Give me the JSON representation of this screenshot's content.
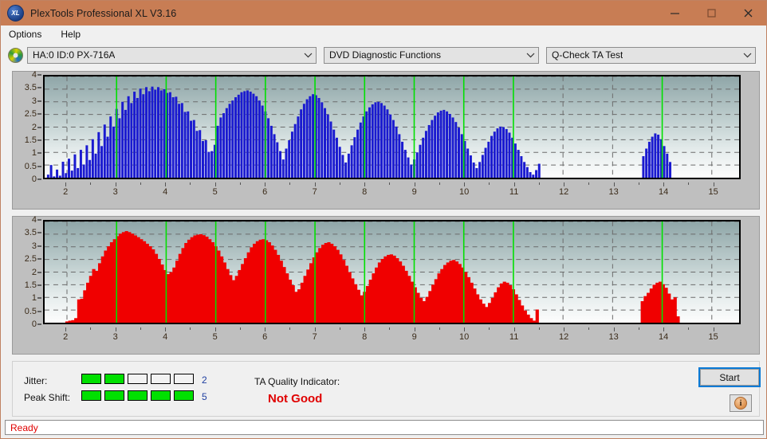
{
  "window": {
    "title": "PlexTools Professional XL V3.16",
    "logo_text": "XL",
    "controls": {
      "minimize": "minimize-icon",
      "maximize": "maximize-icon",
      "close": "close-icon"
    }
  },
  "menu": {
    "items": [
      "Options",
      "Help"
    ]
  },
  "toolbar": {
    "drive": "HA:0 ID:0  PX-716A",
    "function": "DVD Diagnostic Functions",
    "test": "Q-Check TA Test",
    "drive_icon": "disc-icon",
    "chevron": "∨"
  },
  "indicators": {
    "jitter_label": "Jitter:",
    "jitter_value": "2",
    "jitter_filled": 2,
    "jitter_total": 5,
    "peak_shift_label": "Peak Shift:",
    "peak_shift_value": "5",
    "peak_shift_filled": 5,
    "peak_shift_total": 5,
    "tqi_label": "TA Quality Indicator:",
    "tqi_value": "Not Good",
    "tqi_color": "#e00000"
  },
  "buttons": {
    "start": "Start",
    "info": "i"
  },
  "status": {
    "text": "Ready"
  },
  "colors": {
    "titlebar": "#c87d54",
    "top_series": "#1a1ad0",
    "bottom_series": "#f00000",
    "marker": "#00e000",
    "plot_border": "#000000"
  },
  "chart_data": [
    {
      "type": "bar",
      "title": "",
      "xlabel": "",
      "ylabel": "",
      "xlim": [
        1.55,
        15.55
      ],
      "ylim": [
        0,
        4
      ],
      "yticks": [
        0,
        0.5,
        1,
        1.5,
        2,
        2.5,
        3,
        3.5,
        4
      ],
      "xticks": [
        2,
        3,
        4,
        5,
        6,
        7,
        8,
        9,
        10,
        11,
        12,
        13,
        14,
        15
      ],
      "grid": true,
      "series_color": "#1a1ad0",
      "markers": [
        3,
        4,
        5,
        6,
        7,
        8,
        9,
        10,
        11,
        14
      ],
      "marker_color": "#00e000",
      "x": [
        1.62,
        1.68,
        1.74,
        1.8,
        1.86,
        1.92,
        1.98,
        2.04,
        2.1,
        2.16,
        2.22,
        2.28,
        2.34,
        2.4,
        2.46,
        2.52,
        2.58,
        2.64,
        2.7,
        2.76,
        2.82,
        2.88,
        2.94,
        3.0,
        3.06,
        3.12,
        3.18,
        3.24,
        3.3,
        3.36,
        3.42,
        3.48,
        3.54,
        3.6,
        3.66,
        3.72,
        3.78,
        3.84,
        3.9,
        3.96,
        4.02,
        4.08,
        4.14,
        4.2,
        4.26,
        4.32,
        4.38,
        4.44,
        4.5,
        4.56,
        4.62,
        4.68,
        4.74,
        4.8,
        4.86,
        4.92,
        4.98,
        5.04,
        5.1,
        5.16,
        5.22,
        5.28,
        5.34,
        5.4,
        5.46,
        5.52,
        5.58,
        5.64,
        5.7,
        5.76,
        5.82,
        5.88,
        5.94,
        6.0,
        6.06,
        6.12,
        6.18,
        6.24,
        6.3,
        6.36,
        6.42,
        6.48,
        6.54,
        6.6,
        6.66,
        6.72,
        6.78,
        6.84,
        6.9,
        6.96,
        7.02,
        7.08,
        7.14,
        7.2,
        7.26,
        7.32,
        7.38,
        7.44,
        7.5,
        7.56,
        7.62,
        7.68,
        7.74,
        7.8,
        7.86,
        7.92,
        7.98,
        8.04,
        8.1,
        8.16,
        8.22,
        8.28,
        8.34,
        8.4,
        8.46,
        8.52,
        8.58,
        8.64,
        8.7,
        8.76,
        8.82,
        8.88,
        8.94,
        9.0,
        9.06,
        9.12,
        9.18,
        9.24,
        9.3,
        9.36,
        9.42,
        9.48,
        9.54,
        9.6,
        9.66,
        9.72,
        9.78,
        9.84,
        9.9,
        9.96,
        10.02,
        10.08,
        10.14,
        10.2,
        10.26,
        10.32,
        10.38,
        10.44,
        10.5,
        10.56,
        10.62,
        10.68,
        10.74,
        10.8,
        10.86,
        10.92,
        10.98,
        11.04,
        11.1,
        11.16,
        11.22,
        11.28,
        11.34,
        11.4,
        11.46,
        11.52,
        13.62,
        13.68,
        13.74,
        13.8,
        13.86,
        13.92,
        13.98,
        14.04,
        14.1,
        14.16,
        14.22,
        14.28
      ],
      "values": [
        0.12,
        0.5,
        0.05,
        0.32,
        0.08,
        0.63,
        0.18,
        0.75,
        0.28,
        0.92,
        0.38,
        1.1,
        0.52,
        1.28,
        0.7,
        1.52,
        0.95,
        1.8,
        1.25,
        2.1,
        1.62,
        2.42,
        2.02,
        2.72,
        2.35,
        3.0,
        2.68,
        3.22,
        2.95,
        3.4,
        3.15,
        3.52,
        3.3,
        3.58,
        3.42,
        3.6,
        3.48,
        3.58,
        3.45,
        3.5,
        3.35,
        3.38,
        3.18,
        3.2,
        2.92,
        2.95,
        2.6,
        2.62,
        2.25,
        2.28,
        1.85,
        1.88,
        1.45,
        1.48,
        1.02,
        1.05,
        1.3,
        2.05,
        2.38,
        2.55,
        2.75,
        2.92,
        3.05,
        3.18,
        3.28,
        3.38,
        3.42,
        3.45,
        3.4,
        3.32,
        3.22,
        3.05,
        2.85,
        2.62,
        2.35,
        2.05,
        1.72,
        1.4,
        1.05,
        0.72,
        1.15,
        1.48,
        1.82,
        2.12,
        2.42,
        2.7,
        2.92,
        3.1,
        3.22,
        3.3,
        3.26,
        3.15,
        2.98,
        2.75,
        2.5,
        2.22,
        1.9,
        1.58,
        1.22,
        0.9,
        0.6,
        0.95,
        1.28,
        1.6,
        1.9,
        2.18,
        2.42,
        2.62,
        2.78,
        2.9,
        2.98,
        3.0,
        2.95,
        2.85,
        2.7,
        2.5,
        2.28,
        2.02,
        1.72,
        1.42,
        1.1,
        0.8,
        0.52,
        0.72,
        1.0,
        1.3,
        1.58,
        1.85,
        2.08,
        2.28,
        2.45,
        2.58,
        2.65,
        2.68,
        2.62,
        2.52,
        2.38,
        2.2,
        1.98,
        1.72,
        1.45,
        1.15,
        0.88,
        0.6,
        0.38,
        0.62,
        0.9,
        1.18,
        1.42,
        1.65,
        1.82,
        1.95,
        2.02,
        2.0,
        1.92,
        1.78,
        1.58,
        1.35,
        1.1,
        0.85,
        0.62,
        0.42,
        0.22,
        0.12,
        0.3,
        0.55,
        0.85,
        1.15,
        1.42,
        1.62,
        1.75,
        1.7,
        1.52,
        1.25,
        0.95,
        0.62
      ]
    },
    {
      "type": "bar",
      "title": "",
      "xlabel": "",
      "ylabel": "",
      "xlim": [
        1.55,
        15.55
      ],
      "ylim": [
        0,
        4
      ],
      "yticks": [
        0,
        0.5,
        1,
        1.5,
        2,
        2.5,
        3,
        3.5,
        4
      ],
      "xticks": [
        2,
        3,
        4,
        5,
        6,
        7,
        8,
        9,
        10,
        11,
        12,
        13,
        14,
        15
      ],
      "grid": true,
      "series_color": "#f00000",
      "markers": [
        3,
        4,
        5,
        6,
        7,
        8,
        9,
        10,
        11,
        14
      ],
      "marker_color": "#00e000",
      "x": [
        2.0,
        2.06,
        2.12,
        2.18,
        2.24,
        2.3,
        2.36,
        2.42,
        2.48,
        2.54,
        2.6,
        2.66,
        2.72,
        2.78,
        2.84,
        2.9,
        2.96,
        3.02,
        3.08,
        3.14,
        3.2,
        3.26,
        3.32,
        3.38,
        3.44,
        3.5,
        3.56,
        3.62,
        3.68,
        3.74,
        3.8,
        3.86,
        3.92,
        3.98,
        4.04,
        4.1,
        4.16,
        4.22,
        4.28,
        4.34,
        4.4,
        4.46,
        4.52,
        4.58,
        4.64,
        4.7,
        4.76,
        4.82,
        4.88,
        4.94,
        5.0,
        5.06,
        5.12,
        5.18,
        5.24,
        5.3,
        5.36,
        5.42,
        5.48,
        5.54,
        5.6,
        5.66,
        5.72,
        5.78,
        5.84,
        5.9,
        5.96,
        6.02,
        6.08,
        6.14,
        6.2,
        6.26,
        6.32,
        6.38,
        6.44,
        6.5,
        6.56,
        6.62,
        6.68,
        6.74,
        6.8,
        6.86,
        6.92,
        6.98,
        7.04,
        7.1,
        7.16,
        7.22,
        7.28,
        7.34,
        7.4,
        7.46,
        7.52,
        7.58,
        7.64,
        7.7,
        7.76,
        7.82,
        7.88,
        7.94,
        8.0,
        8.06,
        8.12,
        8.18,
        8.24,
        8.3,
        8.36,
        8.42,
        8.48,
        8.54,
        8.6,
        8.66,
        8.72,
        8.78,
        8.84,
        8.9,
        8.96,
        9.02,
        9.08,
        9.14,
        9.2,
        9.26,
        9.32,
        9.38,
        9.44,
        9.5,
        9.56,
        9.62,
        9.68,
        9.74,
        9.8,
        9.86,
        9.92,
        9.98,
        10.04,
        10.1,
        10.16,
        10.22,
        10.28,
        10.34,
        10.4,
        10.46,
        10.52,
        10.58,
        10.64,
        10.7,
        10.76,
        10.82,
        10.88,
        10.94,
        11.0,
        11.06,
        11.12,
        11.18,
        11.24,
        11.3,
        11.36,
        11.42,
        11.48,
        13.6,
        13.66,
        13.72,
        13.78,
        13.84,
        13.9,
        13.96,
        14.02,
        14.08,
        14.14,
        14.2,
        14.26,
        14.32,
        14.38
      ],
      "values": [
        0.05,
        0.08,
        0.1,
        0.18,
        0.92,
        0.95,
        1.28,
        1.58,
        1.85,
        2.12,
        2.05,
        2.35,
        2.62,
        2.85,
        3.02,
        3.18,
        3.3,
        3.42,
        3.52,
        3.58,
        3.62,
        3.58,
        3.52,
        3.45,
        3.38,
        3.3,
        3.22,
        3.12,
        3.02,
        2.9,
        2.72,
        2.52,
        2.3,
        2.08,
        1.92,
        2.0,
        2.18,
        2.45,
        2.72,
        2.95,
        3.15,
        3.28,
        3.38,
        3.45,
        3.48,
        3.5,
        3.46,
        3.4,
        3.3,
        3.18,
        3.02,
        2.85,
        2.62,
        2.38,
        2.12,
        1.88,
        1.68,
        1.85,
        2.08,
        2.32,
        2.55,
        2.78,
        2.98,
        3.12,
        3.22,
        3.28,
        3.3,
        3.26,
        3.18,
        3.05,
        2.88,
        2.68,
        2.45,
        2.2,
        1.95,
        1.7,
        1.48,
        1.22,
        1.32,
        1.58,
        1.85,
        2.1,
        2.35,
        2.58,
        2.78,
        2.95,
        3.08,
        3.15,
        3.18,
        3.12,
        3.02,
        2.88,
        2.7,
        2.48,
        2.25,
        2.0,
        1.75,
        1.52,
        1.3,
        1.08,
        1.22,
        1.45,
        1.7,
        1.95,
        2.18,
        2.38,
        2.52,
        2.62,
        2.68,
        2.7,
        2.65,
        2.55,
        2.42,
        2.25,
        2.05,
        1.85,
        1.62,
        1.4,
        1.18,
        0.98,
        0.85,
        1.02,
        1.25,
        1.5,
        1.72,
        1.95,
        2.12,
        2.28,
        2.38,
        2.45,
        2.48,
        2.42,
        2.32,
        2.18,
        2.0,
        1.8,
        1.58,
        1.35,
        1.12,
        0.92,
        0.75,
        0.62,
        0.78,
        0.98,
        1.2,
        1.4,
        1.55,
        1.62,
        1.58,
        1.48,
        1.32,
        1.12,
        0.9,
        0.68,
        0.48,
        0.32,
        0.18,
        0.08,
        0.52,
        0.85,
        1.05,
        1.18,
        1.35,
        1.5,
        1.58,
        1.62,
        1.52,
        1.38,
        1.15,
        0.92,
        1.0,
        0.25
      ]
    }
  ]
}
